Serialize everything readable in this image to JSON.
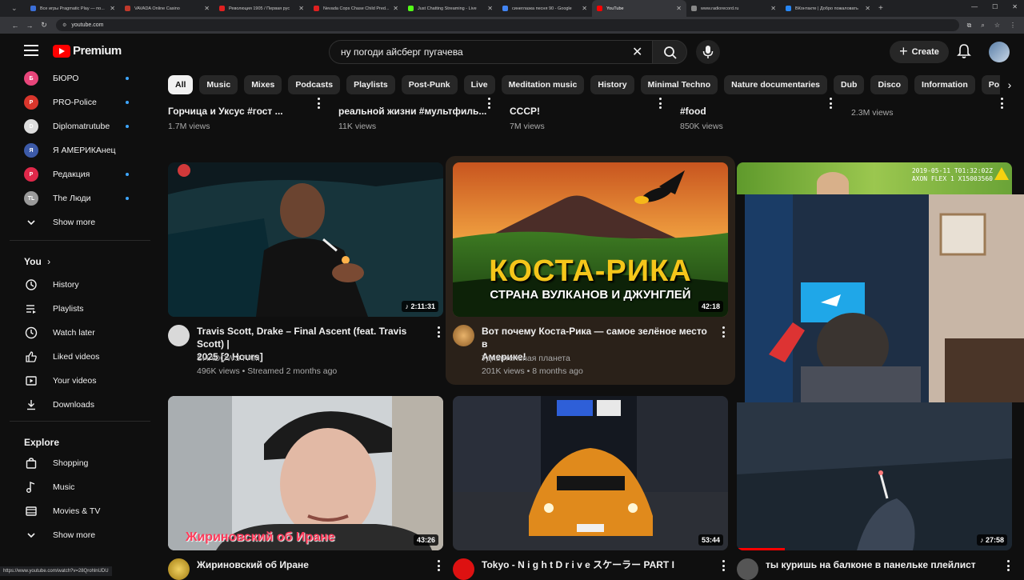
{
  "browser": {
    "tabs": [
      {
        "title": "Все игры Pragmatic Play — по...",
        "color": "#3b6fd8"
      },
      {
        "title": "VAVADA Online Casino",
        "color": "#c0392b"
      },
      {
        "title": "Революция 1905 / Первая рус",
        "color": "#e02020"
      },
      {
        "title": "Nevada Cops Chase Child Pred...",
        "color": "#e02020"
      },
      {
        "title": "Just Chatting Streaming - Live",
        "color": "#53fc18"
      },
      {
        "title": "синеглазка песня 90 - Google",
        "color": "#4285f4"
      },
      {
        "title": "YouTube",
        "color": "#ff0000"
      },
      {
        "title": "www.radiorecord.ru",
        "color": "#888888"
      },
      {
        "title": "ВКонтакте | Добро пожаловать",
        "color": "#2787f5"
      }
    ],
    "url": "youtube.com",
    "status_url": "https://www.youtube.com/watch?v=28QrohlnUDU"
  },
  "header": {
    "logo_text": "Premium",
    "search_value": "ну погоди айсберг пугачева",
    "create_label": "Create"
  },
  "sidebar": {
    "subscriptions": [
      {
        "label": "БЮРО",
        "avatar_text": "Б",
        "color": "#e8457a",
        "dot": true
      },
      {
        "label": "PRO-Police",
        "avatar_text": "P",
        "color": "#d9362c",
        "dot": true
      },
      {
        "label": "Diplomatrutube",
        "avatar_text": "D",
        "color": "#dddddd",
        "dot": true
      },
      {
        "label": "Я АМЕРИКАнец",
        "avatar_text": "Я",
        "color": "#3c5aa8",
        "dot": false
      },
      {
        "label": "Редакция",
        "avatar_text": "P",
        "color": "#e0284a",
        "dot": true
      },
      {
        "label": "The Люди",
        "avatar_text": "TL",
        "color": "#9a9a9a",
        "dot": true
      }
    ],
    "show_more_1": "Show more",
    "you_heading": "You",
    "you_items": [
      {
        "label": "History",
        "icon": "history-icon"
      },
      {
        "label": "Playlists",
        "icon": "playlists-icon"
      },
      {
        "label": "Watch later",
        "icon": "clock-icon"
      },
      {
        "label": "Liked videos",
        "icon": "thumbs-up-icon"
      },
      {
        "label": "Your videos",
        "icon": "play-square-icon"
      },
      {
        "label": "Downloads",
        "icon": "download-icon"
      }
    ],
    "explore_heading": "Explore",
    "explore_items": [
      {
        "label": "Shopping",
        "icon": "shopping-bag-icon"
      },
      {
        "label": "Music",
        "icon": "music-note-icon"
      },
      {
        "label": "Movies & TV",
        "icon": "film-icon"
      }
    ],
    "show_more_2": "Show more"
  },
  "chips": [
    "All",
    "Music",
    "Mixes",
    "Podcasts",
    "Playlists",
    "Post-Punk",
    "Live",
    "Meditation music",
    "History",
    "Minimal Techno",
    "Nature documentaries",
    "Dub",
    "Disco",
    "Information",
    "Pop Music"
  ],
  "partial_row": [
    {
      "title": "Горчица и Уксус #гост ...",
      "views": "1.7M views"
    },
    {
      "title": "реальной жизни #мультфиль...",
      "views": "11K views"
    },
    {
      "title": "СССР!",
      "views": "7M views"
    },
    {
      "title": "#food",
      "views": "850K views"
    },
    {
      "title": "",
      "views": "2.3M views"
    }
  ],
  "videos": [
    {
      "title_line1": "Travis Scott, Drake – Final Ascent (feat. Travis Scott) |",
      "title_line2": "2025 [2 Hours]",
      "channel": "SHADOWS FAM",
      "meta": "496K views • Streamed 2 months ago",
      "duration": "2:11:31"
    },
    {
      "title_line1": "Вот почему Коста-Рика — самое зелёное место в",
      "title_line2": "Америке!",
      "channel": "Удивительная планета",
      "meta": "201K views • 8 months ago",
      "duration": "42:18",
      "thumb_text_1": "КОСТА-РИКА",
      "thumb_text_2": "СТРАНА ВУЛКАНОВ И ДЖУНГЛЕЙ"
    },
    {
      "duration": "27:58",
      "title_line1": "ты куришь на балконе в панельке плейлист",
      "overlay_timestamp": "2019-05-11  T01:32:02Z",
      "overlay_device": "AXON FLEX 1  X15003560"
    },
    {
      "title_line1": "Жириновский об Иране",
      "duration": "43:26",
      "thumb_text": "Жириновский об Иране"
    },
    {
      "title_line1": "Tokyo - N i g h t D r i v e スケーラー PART I",
      "duration": "53:44"
    }
  ]
}
